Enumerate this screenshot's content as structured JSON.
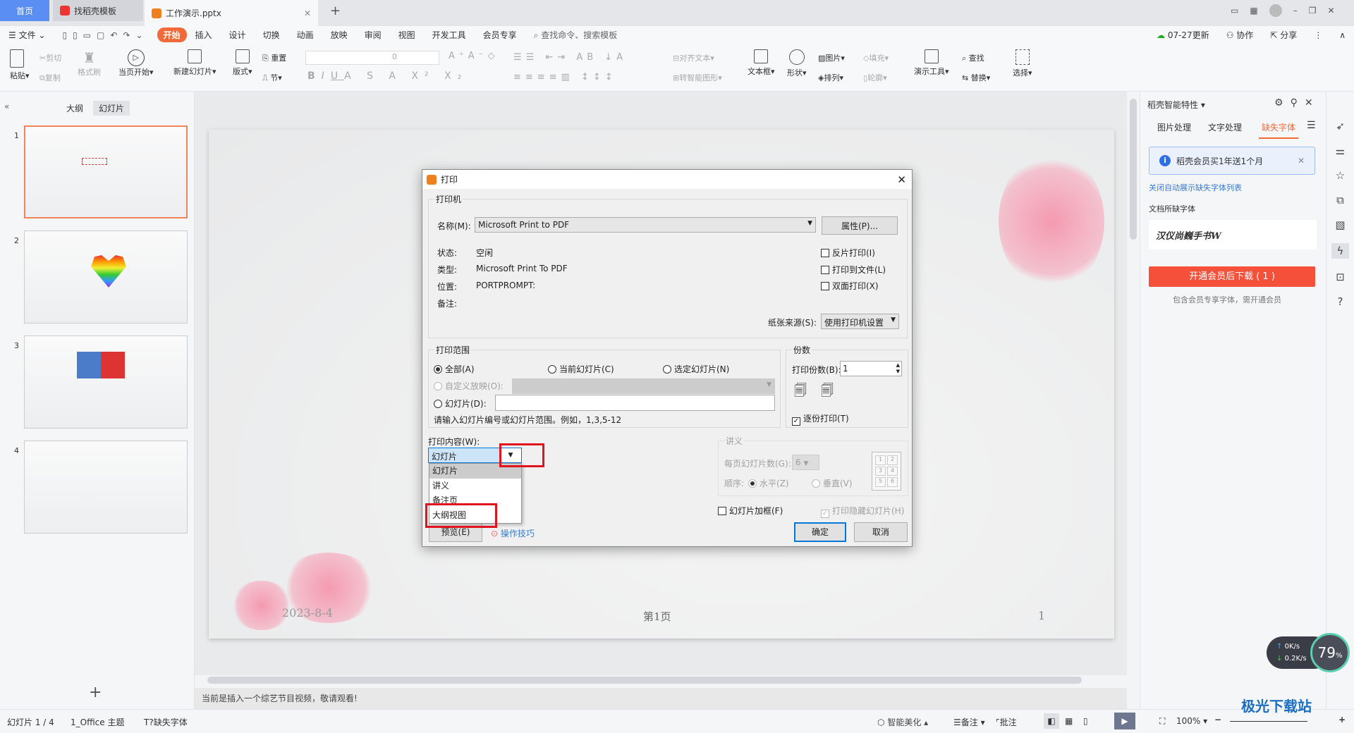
{
  "tabs": [
    {
      "label": "首页"
    },
    {
      "label": "找稻壳模板"
    },
    {
      "label": "工作演示.pptx"
    }
  ],
  "menu": {
    "file": "文件",
    "items": [
      "开始",
      "插入",
      "设计",
      "切换",
      "动画",
      "放映",
      "审阅",
      "视图",
      "开发工具",
      "会员专享"
    ],
    "search": "查找命令、搜索模板",
    "update": "07-27更新",
    "collab": "协作",
    "share": "分享"
  },
  "ribbon": {
    "paste": "粘贴",
    "cut": "剪切",
    "copy": "复制",
    "format_painter": "格式刷",
    "play_from_current": "当页开始",
    "new_slide": "新建幻灯片",
    "layout": "版式",
    "reset": "重置",
    "section": "节",
    "font_size": "0",
    "align_text": "对齐文本",
    "smartart": "转智能图形",
    "textbox": "文本框",
    "shape": "形状",
    "picture": "图片",
    "arrange": "排列",
    "fill": "填充",
    "outline": "轮廓",
    "present_tools": "演示工具",
    "find": "查找",
    "replace": "替换",
    "select": "选择"
  },
  "left": {
    "tab_outline": "大纲",
    "tab_slides": "幻灯片",
    "slides": [
      "1",
      "2",
      "3",
      "4"
    ]
  },
  "slide": {
    "date": "2023-8-4",
    "page": "第1页",
    "number": "1"
  },
  "notes": "当前是插入一个综艺节目视频，敬请观看!",
  "right": {
    "title": "稻壳智能特性",
    "tabs": [
      "图片处理",
      "文字处理",
      "缺失字体"
    ],
    "banner": "稻壳会员买1年送1个月",
    "close_link": "关闭自动展示缺失字体列表",
    "missing_label": "文档所缺字体",
    "font_name": "汉仪尚巍手书W",
    "download": "开通会员后下载 ( 1 )",
    "note": "包含会员专享字体，需开通会员"
  },
  "status": {
    "slide": "幻灯片 1 / 4",
    "theme": "1_Office 主题",
    "missing": "缺失字体",
    "beautify": "智能美化",
    "notes": "备注",
    "comment": "批注",
    "zoom": "100%"
  },
  "net": {
    "up": "0K/s",
    "down": "0.2K/s",
    "cpu": "79",
    "unit": "%"
  },
  "dialog": {
    "title": "打印",
    "printer_group": "打印机",
    "name_label": "名称(M):",
    "name_value": "Microsoft Print to PDF",
    "properties": "属性(P)...",
    "status_label": "状态:",
    "status_value": "空闲",
    "type_label": "类型:",
    "type_value": "Microsoft Print To PDF",
    "where_label": "位置:",
    "where_value": "PORTPROMPT:",
    "comment_label": "备注:",
    "reverse": "反片打印(I)",
    "to_file": "打印到文件(L)",
    "duplex": "双面打印(X)",
    "paper_label": "纸张来源(S):",
    "paper_value": "使用打印机设置",
    "range_group": "打印范围",
    "all": "全部(A)",
    "current": "当前幻灯片(C)",
    "selected": "选定幻灯片(N)",
    "custom": "自定义放映(O):",
    "slides": "幻灯片(D):",
    "hint": "请输入幻灯片编号或幻灯片范围。例如，1,3,5-12",
    "copies_group": "份数",
    "copies_label": "打印份数(B):",
    "copies_value": "1",
    "collate": "逐份打印(T)",
    "content_label": "打印内容(W):",
    "content_value": "幻灯片",
    "content_options": [
      "幻灯片",
      "讲义",
      "备注页",
      "大纲视图"
    ],
    "handout_group": "讲义",
    "per_page_label": "每页幻灯片数(G):",
    "per_page_value": "6",
    "order_label": "顺序:",
    "horizontal": "水平(Z)",
    "vertical": "垂直(V)",
    "grid": [
      "1",
      "2",
      "3",
      "4",
      "5",
      "6"
    ],
    "frame": "幻灯片加框(F)",
    "print_hidden": "打印隐藏幻灯片(H)",
    "preview": "预览(E)",
    "tips": "操作技巧",
    "ok": "确定",
    "cancel": "取消"
  },
  "colors": {
    "accent": "#f26a3a",
    "highlight_box": "#e0141e",
    "download_btn": "#f5503a",
    "link": "#3a7bd5"
  }
}
